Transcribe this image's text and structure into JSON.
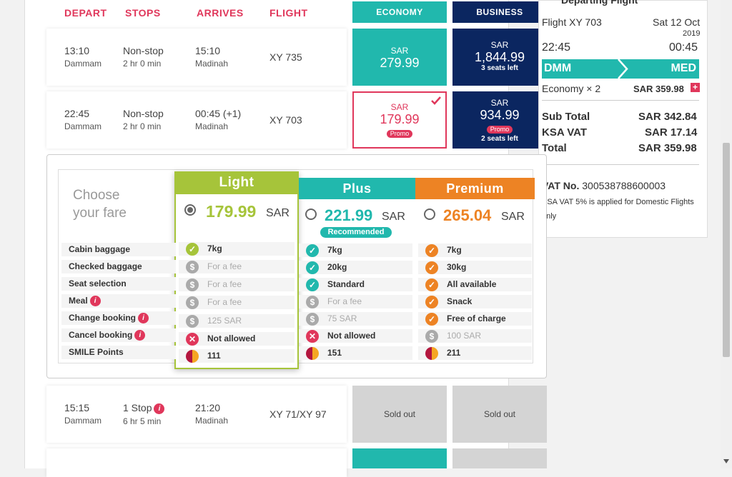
{
  "columns": {
    "depart": "DEPART",
    "stops": "STOPS",
    "arrives": "ARRIVES",
    "flight": "FLIGHT",
    "economy": "ECONOMY",
    "business": "BUSINESS"
  },
  "flights": [
    {
      "depart_time": "13:10",
      "depart_city": "Dammam",
      "stops": "Non-stop",
      "duration": "2 hr 0 min",
      "arrive_time": "15:10",
      "arrive_city": "Madinah",
      "flight": "XY 735",
      "eco_cur": "SAR",
      "eco_amt": "279.99",
      "bus_cur": "SAR",
      "bus_amt": "1,844.99",
      "bus_note": "3 seats left"
    },
    {
      "depart_time": "22:45",
      "depart_city": "Dammam",
      "stops": "Non-stop",
      "duration": "2 hr 0 min",
      "arrive_time": "00:45 (+1)",
      "arrive_city": "Madinah",
      "flight": "XY 703",
      "eco_cur": "SAR",
      "eco_amt": "179.99",
      "eco_promo": "Promo",
      "bus_cur": "SAR",
      "bus_amt": "934.99",
      "bus_promo": "Promo",
      "bus_note": "2 seats left"
    },
    {
      "depart_time": "15:15",
      "depart_city": "Dammam",
      "stops": "1 Stop",
      "duration": "6 hr 5 min",
      "arrive_time": "21:20",
      "arrive_city": "Madinah",
      "flight": "XY 71/XY 97",
      "eco_status": "Sold out",
      "bus_status": "Sold out"
    }
  ],
  "fare": {
    "choose": "Choose",
    "your_fare": "your fare",
    "labels": [
      "Cabin baggage",
      "Checked baggage",
      "Seat selection",
      "Meal",
      "Change booking",
      "Cancel booking",
      "SMILE Points"
    ],
    "light": {
      "name": "Light",
      "price": "179.99",
      "cur": "SAR",
      "items": [
        "7kg",
        "For a fee",
        "For a fee",
        "For a fee",
        "125 SAR",
        "Not allowed",
        "111"
      ]
    },
    "plus": {
      "name": "Plus",
      "price": "221.99",
      "cur": "SAR",
      "badge": "Recommended",
      "items": [
        "7kg",
        "20kg",
        "Standard",
        "For a fee",
        "75 SAR",
        "Not allowed",
        "151"
      ]
    },
    "premium": {
      "name": "Premium",
      "price": "265.04",
      "cur": "SAR",
      "items": [
        "7kg",
        "30kg",
        "All available",
        "Snack",
        "Free of charge",
        "100 SAR",
        "211"
      ]
    }
  },
  "summary": {
    "flight": "Flight XY 703",
    "date": "Sat 12 Oct",
    "year": "2019",
    "dep_time": "22:45",
    "arr_time": "00:45",
    "from": "DMM",
    "to": "MED",
    "pax": "Economy × 2",
    "pax_price": "SAR 359.98",
    "subtotal_label": "Sub Total",
    "subtotal": "SAR 342.84",
    "vat_label": "KSA VAT",
    "vat": "SAR 17.14",
    "total_label": "Total",
    "total": "SAR 359.98",
    "vat_no_label": "VAT No.",
    "vat_no": "300538788600003",
    "vat_note": "KSA VAT 5% is applied for Domestic Flights only",
    "heading": "Departing Flight"
  },
  "colors": {
    "pink": "#e0375b",
    "teal": "#21b8ad",
    "navy": "#0b2660",
    "lime": "#a6c43a",
    "orange": "#ed8324"
  }
}
